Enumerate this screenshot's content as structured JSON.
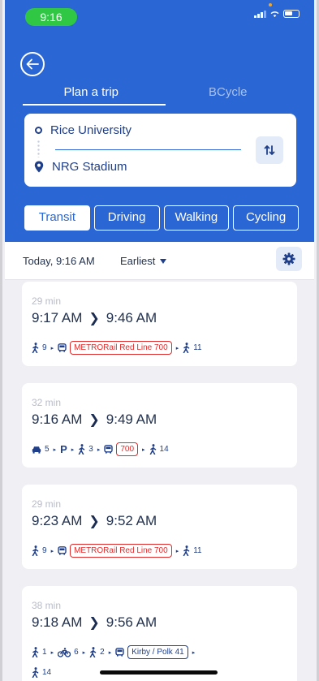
{
  "status_bar": {
    "time": "9:16"
  },
  "header": {
    "tabs": [
      {
        "label": "Plan a trip",
        "active": true
      },
      {
        "label": "BCycle",
        "active": false
      }
    ]
  },
  "route": {
    "origin": "Rice University",
    "destination": "NRG Stadium"
  },
  "modes": [
    {
      "label": "Transit",
      "active": true
    },
    {
      "label": "Driving",
      "active": false
    },
    {
      "label": "Walking",
      "active": false
    },
    {
      "label": "Cycling",
      "active": false
    }
  ],
  "toolbar": {
    "when": "Today, 9:16 AM",
    "sort": "Earliest"
  },
  "trips": [
    {
      "duration": "29 min",
      "depart": "9:17 AM",
      "arrive": "9:46 AM",
      "legs": [
        {
          "icon": "walk-icon",
          "text": "9"
        },
        {
          "icon": "bus-icon",
          "badge": "METRORail Red Line 700",
          "badge_color": "red"
        },
        {
          "icon": "walk-icon",
          "text": "11"
        }
      ]
    },
    {
      "duration": "32 min",
      "depart": "9:16 AM",
      "arrive": "9:49 AM",
      "legs": [
        {
          "icon": "car-icon",
          "text": "5"
        },
        {
          "icon": "parking-icon",
          "text": ""
        },
        {
          "icon": "walk-icon",
          "text": "3"
        },
        {
          "icon": "bus-icon",
          "badge": "700",
          "badge_color": "red"
        },
        {
          "icon": "walk-icon",
          "text": "14"
        }
      ]
    },
    {
      "duration": "29 min",
      "depart": "9:23 AM",
      "arrive": "9:52 AM",
      "legs": [
        {
          "icon": "walk-icon",
          "text": "9"
        },
        {
          "icon": "bus-icon",
          "badge": "METRORail Red Line 700",
          "badge_color": "red"
        },
        {
          "icon": "walk-icon",
          "text": "11"
        }
      ]
    },
    {
      "duration": "38 min",
      "depart": "9:18 AM",
      "arrive": "9:56 AM",
      "legs": [
        {
          "icon": "walk-icon",
          "text": "1"
        },
        {
          "icon": "bike-icon",
          "text": "6"
        },
        {
          "icon": "walk-icon",
          "text": "2"
        },
        {
          "icon": "bus-icon",
          "badge": "Kirby / Polk 41",
          "badge_color": "blue"
        }
      ],
      "overflow_legs": [
        {
          "icon": "walk-icon",
          "text": "14"
        }
      ]
    }
  ],
  "colors": {
    "header_blue": "#2a66d4",
    "navy": "#1f3f8a",
    "rail_red": "#e12b2b",
    "status_green": "#2fc744"
  }
}
